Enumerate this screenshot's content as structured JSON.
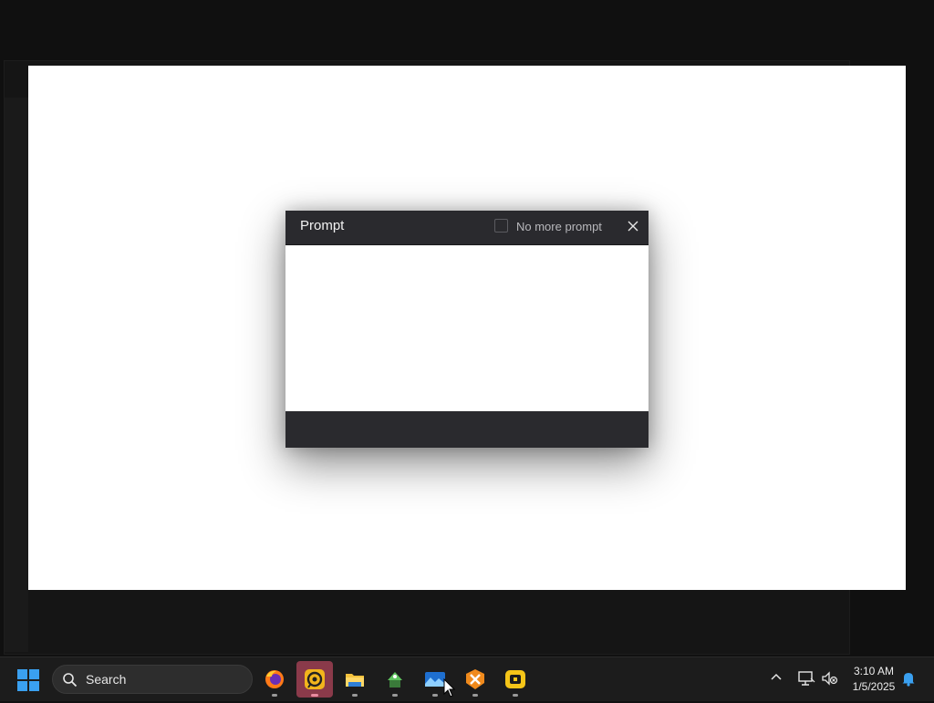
{
  "dialog": {
    "title": "Prompt",
    "no_more_prompt_label": "No more prompt",
    "no_more_prompt_checked": false
  },
  "taskbar": {
    "search_placeholder": "Search",
    "apps": [
      {
        "name": "firefox",
        "icon": "firefox-icon",
        "active": false
      },
      {
        "name": "app-orange-circle",
        "icon": "orange-circle-app-icon",
        "active": true
      },
      {
        "name": "file-explorer",
        "icon": "folder-icon",
        "active": false
      },
      {
        "name": "app-green",
        "icon": "green-app-icon",
        "active": false
      },
      {
        "name": "app-blue-picture",
        "icon": "picture-app-icon",
        "active": false
      },
      {
        "name": "app-orange-tools",
        "icon": "tools-app-icon",
        "active": false
      },
      {
        "name": "app-yellow",
        "icon": "yellow-app-icon",
        "active": false
      }
    ],
    "time": "3:10 AM",
    "date": "1/5/2025"
  },
  "colors": {
    "dialog_titlebar": "#2a2a2e",
    "active_app_highlight": "#8a3a4a",
    "taskbar": "#1c1c1c"
  }
}
